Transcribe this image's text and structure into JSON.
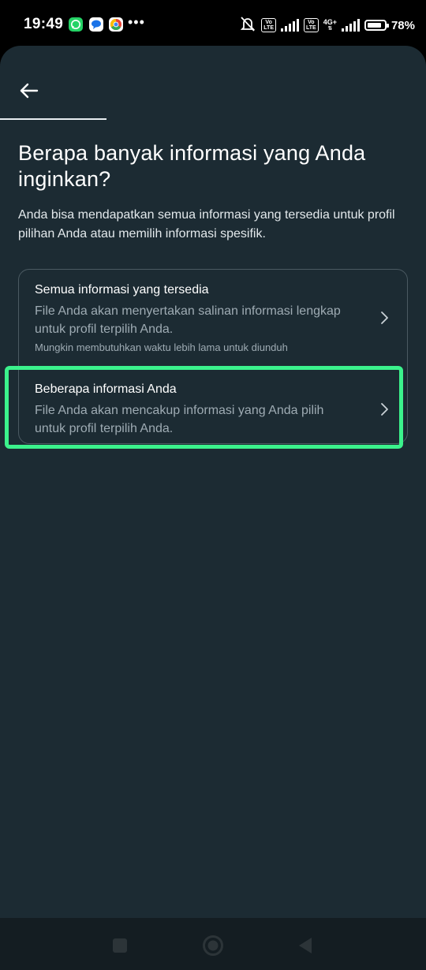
{
  "status_bar": {
    "time": "19:49",
    "more_indicator": "•••",
    "network_label": "4G+",
    "volte_label": "Vo\nLTE",
    "battery_percent_label": "78%",
    "battery_level": 0.78,
    "app_icons": [
      "whatsapp-icon",
      "messages-icon",
      "chrome-icon"
    ],
    "colors": {
      "whatsapp": "#25d366",
      "messages": "#1a73e8",
      "chrome": "#ffffff"
    }
  },
  "header": {
    "back_icon": "arrow-left-icon"
  },
  "page": {
    "title": "Berapa banyak informasi yang Anda inginkan?",
    "description": "Anda bisa mendapatkan semua informasi yang tersedia untuk profil pilihan Anda atau memilih informasi spesifik."
  },
  "options": [
    {
      "title": "Semua informasi yang tersedia",
      "description": "File Anda akan menyertakan salinan informasi lengkap untuk profil terpilih Anda.",
      "note": "Mungkin membutuhkan waktu lebih lama untuk diunduh"
    },
    {
      "title": "Beberapa informasi Anda",
      "description": "File Anda akan mencakup informasi yang Anda pilih untuk profil terpilih Anda."
    }
  ],
  "colors": {
    "background": "#1c2b33",
    "highlight": "#3bf28c",
    "card_border": "#4b5a62",
    "secondary_text": "#9eabb3"
  },
  "nav_bar": {
    "icons": [
      "square-recents-icon",
      "circle-home-icon",
      "triangle-back-icon"
    ]
  }
}
